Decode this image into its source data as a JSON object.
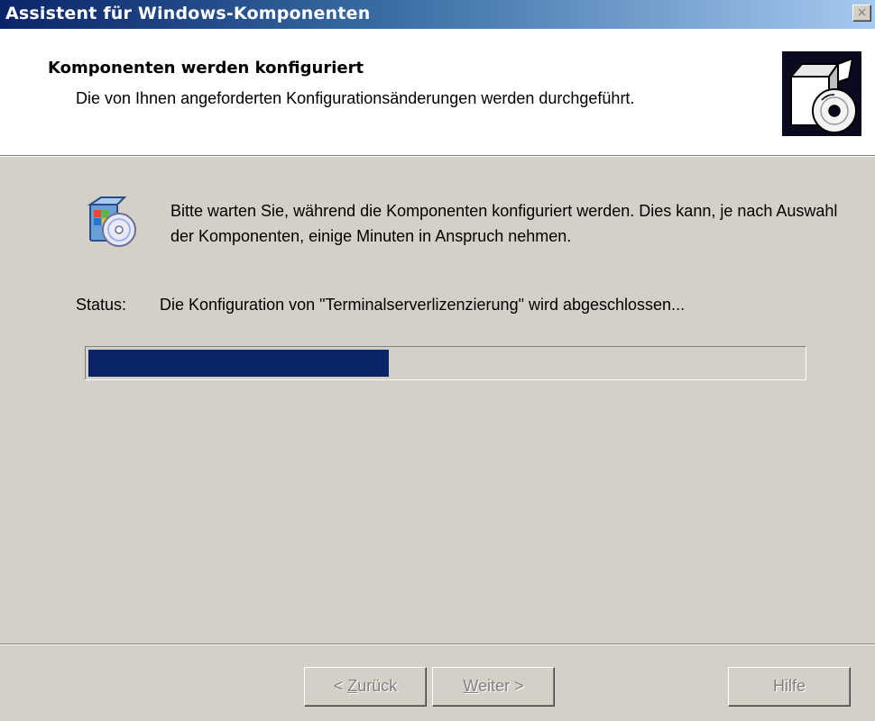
{
  "window": {
    "title": "Assistent für Windows-Komponenten",
    "close_label": "×"
  },
  "header": {
    "title": "Komponenten werden konfiguriert",
    "subtitle": "Die von Ihnen angeforderten Konfigurationsänderungen werden durchgeführt.",
    "icon": "box-cd-icon"
  },
  "content": {
    "icon": "windows-components-cd-icon",
    "info_text": "Bitte warten Sie, während die Komponenten konfiguriert werden. Dies kann, je nach Auswahl der Komponenten, einige Minuten in Anspruch nehmen.",
    "status_label": "Status:",
    "status_text": "Die Konfiguration von \"Terminalserverlizenzierung\" wird abgeschlossen...",
    "progress_fraction": 0.42
  },
  "buttons": {
    "back": {
      "prefix": "< ",
      "mnemonic": "Z",
      "rest": "urück",
      "enabled": false
    },
    "next": {
      "prefix": "",
      "mnemonic": "W",
      "rest": "eiter >",
      "enabled": false
    },
    "help": {
      "label": "Hilfe",
      "enabled": false
    }
  },
  "colors": {
    "titlebar_start": "#0a246a",
    "titlebar_end": "#a6caf0",
    "progress_fill": "#0a246a",
    "dialog_face": "#d4d0c8"
  }
}
